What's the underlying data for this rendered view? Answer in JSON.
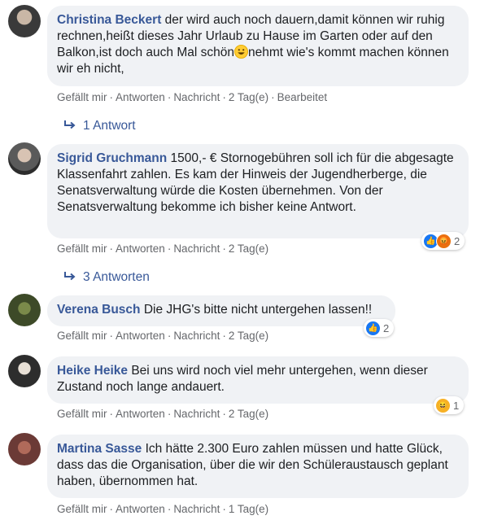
{
  "comments": [
    {
      "author": "Christina Beckert",
      "text_a": "der wird auch noch dauern,damit können wir ruhig rechnen,heißt dieses Jahr Urlaub zu Hause im Garten oder auf den Balkon,ist doch auch Mal schön",
      "emoji": "grinning-face-icon",
      "text_b": "nehmt wie's kommt machen können wir eh nicht,",
      "age": "2 Tag(e)",
      "edited": "Bearbeitet",
      "replies": "1 Antwort"
    },
    {
      "author": "Sigrid Gruchmann",
      "text": "1500,- € Stornogebühren soll ich für die abgesagte Klassenfahrt zahlen. Es kam der Hinweis der Jugendherberge, die Senatsverwaltung würde die Kosten übernehmen. Von der Senatsverwaltung bekomme ich bisher keine Antwort.",
      "age": "2 Tag(e)",
      "reaction_count": "2",
      "reactions": [
        "like",
        "angry"
      ],
      "replies": "3 Antworten"
    },
    {
      "author": "Verena Busch",
      "text": "Die JHG's bitte nicht untergehen lassen!!",
      "age": "2 Tag(e)",
      "reaction_count": "2",
      "reactions": [
        "like"
      ]
    },
    {
      "author": "Heike Heike",
      "text": "Bei uns wird noch viel mehr untergehen, wenn dieser Zustand noch lange andauert.",
      "age": "2 Tag(e)",
      "reaction_count": "1",
      "reactions": [
        "haha"
      ]
    },
    {
      "author": "Martina Sasse",
      "text": "Ich hätte 2.300 Euro zahlen müssen und hatte Glück, dass das die Organisation, über die wir den Schüleraustausch geplant haben, übernommen hat.",
      "age": "1 Tag(e)"
    }
  ],
  "labels": {
    "like": "Gefällt mir",
    "reply": "Antworten",
    "message": "Nachricht",
    "sep": "·"
  },
  "colors": {
    "link": "#385898",
    "meta": "#65676b",
    "bubble": "#f0f2f5",
    "like": "#1877f2",
    "angry": "#e9710f",
    "haha": "#f7b125"
  }
}
